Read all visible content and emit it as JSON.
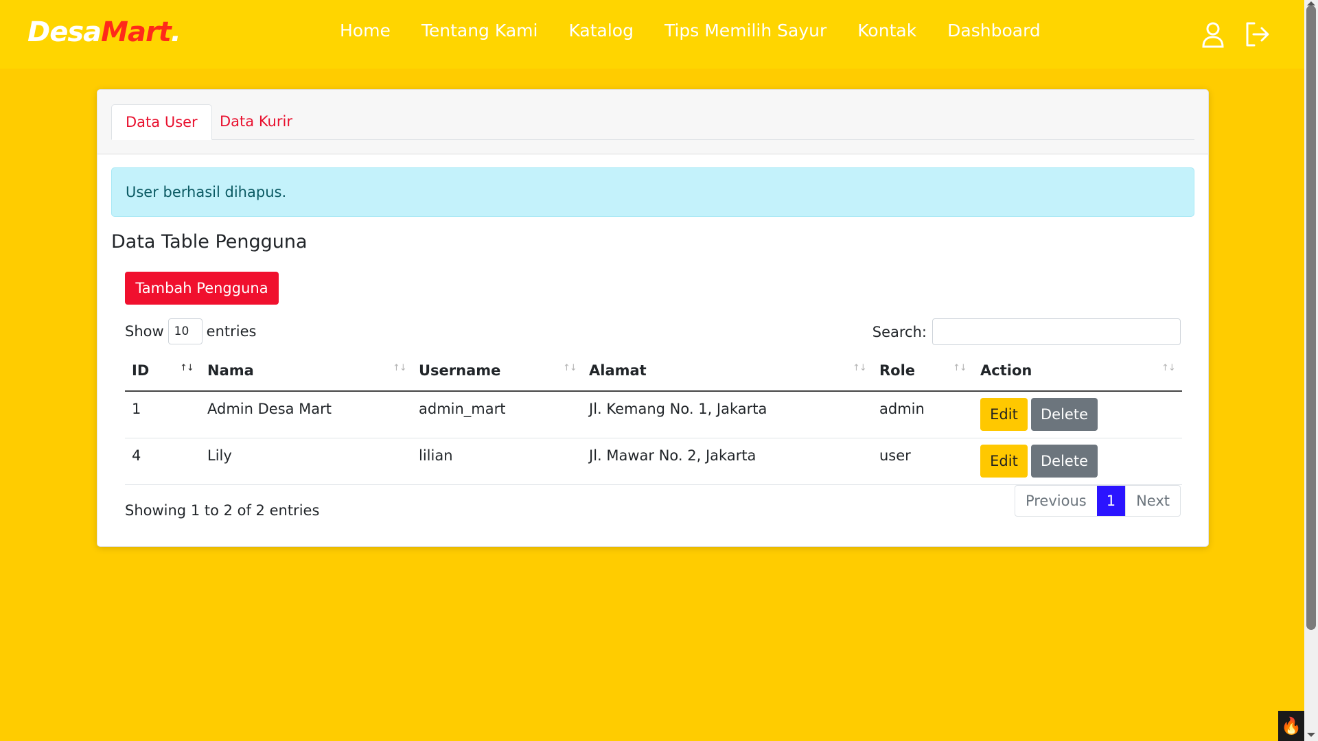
{
  "navbar": {
    "brand_part1": "Desa",
    "brand_part2": "Mart",
    "brand_dot": ".",
    "links": [
      "Home",
      "Tentang Kami",
      "Katalog",
      "Tips Memilih Sayur",
      "Kontak",
      "Dashboard"
    ],
    "icons": [
      "user-icon",
      "logout-icon"
    ]
  },
  "tabs": [
    "Data User",
    "Data Kurir"
  ],
  "alert": {
    "message": "User berhasil dihapus."
  },
  "section_title": "Data Table Pengguna",
  "add_button": "Tambah Pengguna",
  "length": {
    "prefix": "Show",
    "value": "10",
    "suffix": "entries"
  },
  "search": {
    "label": "Search:",
    "value": ""
  },
  "table": {
    "headers": [
      "ID",
      "Nama",
      "Username",
      "Alamat",
      "Role",
      "Action"
    ],
    "rows": [
      {
        "id": "1",
        "nama": "Admin Desa Mart",
        "username": "admin_mart",
        "alamat": "Jl. Kemang No. 1, Jakarta",
        "role": "admin",
        "edit": "Edit",
        "delete": "Delete"
      },
      {
        "id": "4",
        "nama": "Lily",
        "username": "lilian",
        "alamat": "Jl. Mawar No. 2, Jakarta",
        "role": "user",
        "edit": "Edit",
        "delete": "Delete"
      }
    ]
  },
  "info": "Showing 1 to 2 of 2 entries",
  "pagination": {
    "previous": "Previous",
    "current": "1",
    "next": "Next"
  },
  "colors": {
    "background": "#ffcc00",
    "accent_red": "#f0102e",
    "edit_yellow": "#ffc800",
    "delete_gray": "#6c757d",
    "page_active": "#2b14ff",
    "alert_bg": "#c4f2fb"
  }
}
